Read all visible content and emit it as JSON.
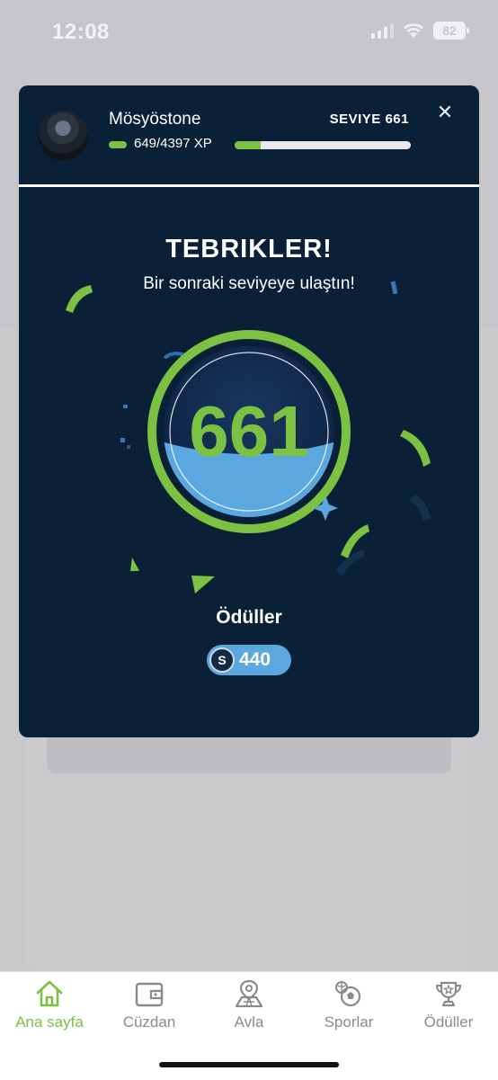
{
  "status_bar": {
    "time": "12:08",
    "battery": "82"
  },
  "modal": {
    "username": "Mösyöstone",
    "xp_text": "649/4397 XP",
    "xp_progress": 0.1476,
    "level_label": "SEVIYE 661",
    "title": "TEBRIKLER!",
    "subtitle": "Bir sonraki seviyeye ulaştın!",
    "level_number": "661",
    "rewards_title": "Ödüller",
    "reward_amount": "440"
  },
  "tabs": [
    {
      "label": "Ana sayfa",
      "icon": "home-icon",
      "active": true
    },
    {
      "label": "Cüzdan",
      "icon": "wallet-icon",
      "active": false
    },
    {
      "label": "Avla",
      "icon": "map-pin-icon",
      "active": false
    },
    {
      "label": "Sporlar",
      "icon": "sports-ball-icon",
      "active": false
    },
    {
      "label": "Ödüller",
      "icon": "trophy-icon",
      "active": false
    }
  ],
  "colors": {
    "accent": "#7bc242",
    "modal_bg": "#0a2037",
    "badge_blue": "#5ba8e0"
  }
}
